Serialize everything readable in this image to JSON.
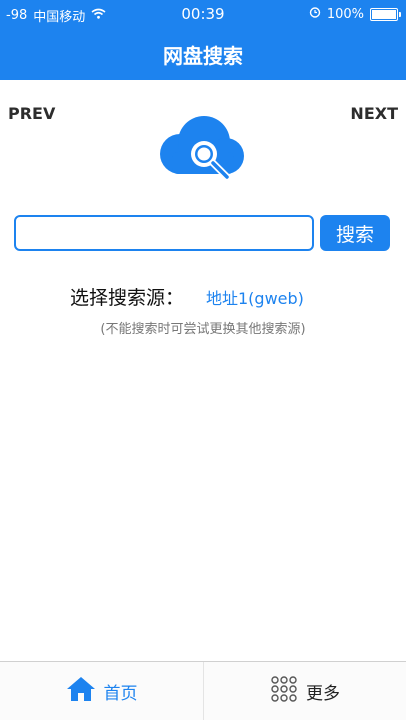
{
  "status_bar": {
    "signal": "-98",
    "carrier": "中国移动",
    "time": "00:39",
    "battery": "100%",
    "battery_level": 1.0
  },
  "nav": {
    "title": "网盘搜索"
  },
  "pager": {
    "prev": "PREV",
    "next": "NEXT"
  },
  "search": {
    "value": "",
    "placeholder": "",
    "button_label": "搜索"
  },
  "source": {
    "label": "选择搜索源：",
    "value": "地址1(gweb)",
    "hint": "(不能搜索时可尝试更换其他搜索源)"
  },
  "tabs": [
    {
      "label": "首页",
      "icon": "home-icon",
      "active": true
    },
    {
      "label": "更多",
      "icon": "grid-dots-icon",
      "active": false
    }
  ],
  "colors": {
    "accent": "#1d83ef",
    "white": "#ffffff"
  }
}
